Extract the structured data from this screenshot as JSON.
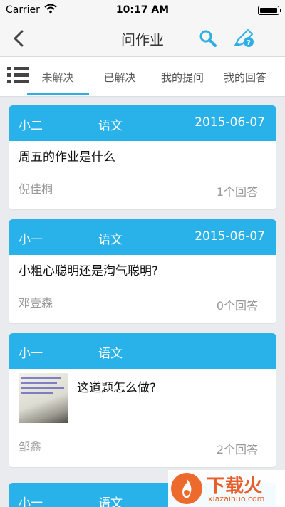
{
  "status_bar": {
    "carrier": "Carrier",
    "time": "10:17 AM"
  },
  "nav": {
    "title": "问作业",
    "back_icon": "chevron-left-icon",
    "search_icon": "search-icon",
    "ask_icon": "pencil-question-icon",
    "accent": "#2eaee4"
  },
  "tabs": [
    {
      "label": "未解决",
      "active": true
    },
    {
      "label": "已解决",
      "active": false
    },
    {
      "label": "我的提问",
      "active": false
    },
    {
      "label": "我的回答",
      "active": false
    }
  ],
  "cards": [
    {
      "author": "小二",
      "subject": "语文",
      "date": "2015-06-07",
      "question": "周五的作业是什么",
      "student": "倪佳桐",
      "answers": "1个回答"
    },
    {
      "author": "小一",
      "subject": "语文",
      "date": "2015-06-07",
      "question": "小粗心聪明还是淘气聪明?",
      "student": "邓壹森",
      "answers": "0个回答"
    },
    {
      "author": "小一",
      "subject": "语文",
      "date": "",
      "question": "这道题怎么做?",
      "student": "邹鑫",
      "answers": "2个回答"
    },
    {
      "author": "小一",
      "subject": "语文"
    }
  ],
  "watermark": {
    "brand": "下载火",
    "domain": "xiazaihuo.com"
  },
  "colors": {
    "card_header": "#29b1ea",
    "background": "#e9ebee",
    "watermark": "#e85e2a"
  }
}
